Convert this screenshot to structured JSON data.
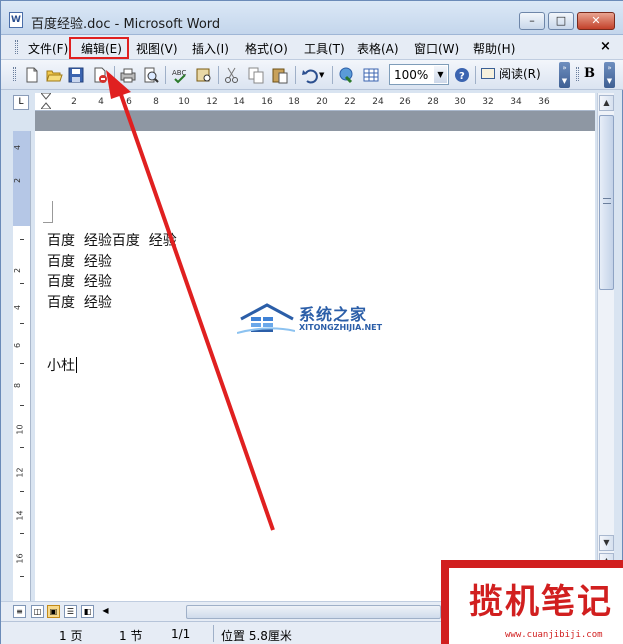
{
  "window": {
    "title": "百度经验.doc - Microsoft Word",
    "icon_label": "W",
    "minimize": "–",
    "maximize": "□",
    "close": "✕"
  },
  "menu": {
    "items": [
      {
        "label": "文件(F)"
      },
      {
        "label": "编辑(E)"
      },
      {
        "label": "视图(V)"
      },
      {
        "label": "插入(I)"
      },
      {
        "label": "格式(O)"
      },
      {
        "label": "工具(T)"
      },
      {
        "label": "表格(A)"
      },
      {
        "label": "窗口(W)"
      },
      {
        "label": "帮助(H)"
      }
    ],
    "close": "×",
    "highlighted_item": "编辑(E)"
  },
  "toolbar": {
    "zoom": "100%",
    "read_label": "阅读(R)",
    "bold_label": "B",
    "icons": [
      "new-icon",
      "open-icon",
      "save-icon",
      "permission-icon",
      "print-icon",
      "print-preview-icon",
      "spelling-icon",
      "research-icon",
      "cut-icon",
      "copy-icon",
      "paste-icon",
      "undo-icon",
      "hyperlink-icon",
      "table-icon",
      "help-icon",
      "read-icon"
    ]
  },
  "ruler": {
    "corner": "L",
    "ticks": [
      "2",
      "4",
      "6",
      "8",
      "10",
      "12",
      "14",
      "16",
      "18",
      "20",
      "22",
      "24",
      "26",
      "28",
      "30",
      "32",
      "34",
      "36"
    ],
    "vticks": [
      "4",
      "2",
      "2",
      "4",
      "6",
      "8",
      "10",
      "12",
      "14",
      "16"
    ]
  },
  "document": {
    "lines": [
      "百度  经验百度  经验",
      "百度  经验",
      "百度  经验",
      "百度  经验",
      "小杜"
    ]
  },
  "watermark": {
    "title": "系统之家",
    "subtitle": "XITONGZHIJIA.NET"
  },
  "statusbar": {
    "page": "1 页",
    "section": "1 节",
    "page_of": "1/1",
    "position": "位置 5.8厘米"
  },
  "brand": {
    "name": "揽机笔记",
    "url": "www.cuanjibiji.com"
  },
  "colors": {
    "annotation": "#e02020",
    "brand": "#d11f1f",
    "watermark": "#2b5ea8"
  }
}
